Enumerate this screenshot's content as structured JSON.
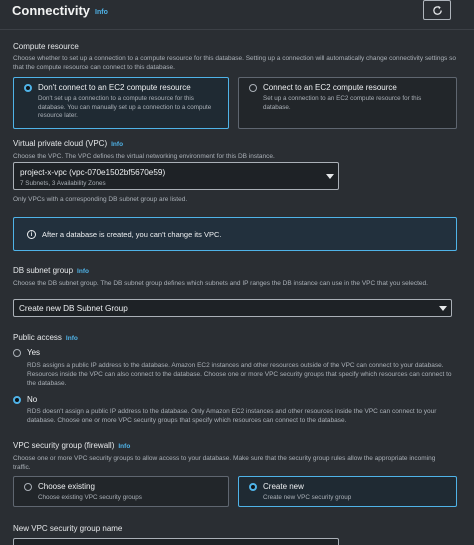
{
  "header": {
    "title": "Connectivity",
    "info": "Info"
  },
  "compute": {
    "label": "Compute resource",
    "description": "Choose whether to set up a connection to a compute resource for this database. Setting up a connection will automatically change connectivity settings so that the compute resource can connect to this database.",
    "options": [
      {
        "title": "Don't connect to an EC2 compute resource",
        "description": "Don't set up a connection to a compute resource for this database. You can manually set up a connection to a compute resource later.",
        "selected": true
      },
      {
        "title": "Connect to an EC2 compute resource",
        "description": "Set up a connection to an EC2 compute resource for this database.",
        "selected": false
      }
    ]
  },
  "vpc": {
    "label": "Virtual private cloud (VPC)",
    "info": "Info",
    "description": "Choose the VPC. The VPC defines the virtual networking environment for this DB instance.",
    "selected_value": "project-x-vpc (vpc-070e1502bf5670e59)",
    "selected_sub": "7 Subnets, 3 Availability Zones",
    "note": "Only VPCs with a corresponding DB subnet group are listed."
  },
  "alert": {
    "text": "After a database is created, you can't change its VPC."
  },
  "subnet": {
    "label": "DB subnet group",
    "info": "Info",
    "description": "Choose the DB subnet group. The DB subnet group defines which subnets and IP ranges the DB instance can use in the VPC that you selected.",
    "selected_value": "Create new DB Subnet Group"
  },
  "public_access": {
    "label": "Public access",
    "info": "Info",
    "options": [
      {
        "label": "Yes",
        "description": "RDS assigns a public IP address to the database. Amazon EC2 instances and other resources outside of the VPC can connect to your database. Resources inside the VPC can also connect to the database. Choose one or more VPC security groups that specify which resources can connect to the database.",
        "selected": false
      },
      {
        "label": "No",
        "description": "RDS doesn't assign a public IP address to the database. Only Amazon EC2 instances and other resources inside the VPC can connect to your database. Choose one or more VPC security groups that specify which resources can connect to the database.",
        "selected": true
      }
    ]
  },
  "security_group": {
    "label": "VPC security group (firewall)",
    "info": "Info",
    "description": "Choose one or more VPC security groups to allow access to your database. Make sure that the security group rules allow the appropriate incoming traffic.",
    "options": [
      {
        "title": "Choose existing",
        "description": "Choose existing VPC security groups",
        "selected": false
      },
      {
        "title": "Create new",
        "description": "Create new VPC security group",
        "selected": true
      }
    ]
  },
  "new_sg": {
    "label": "New VPC security group name"
  },
  "colors": {
    "accent": "#4fb3e8",
    "background": "#2a2e33"
  }
}
